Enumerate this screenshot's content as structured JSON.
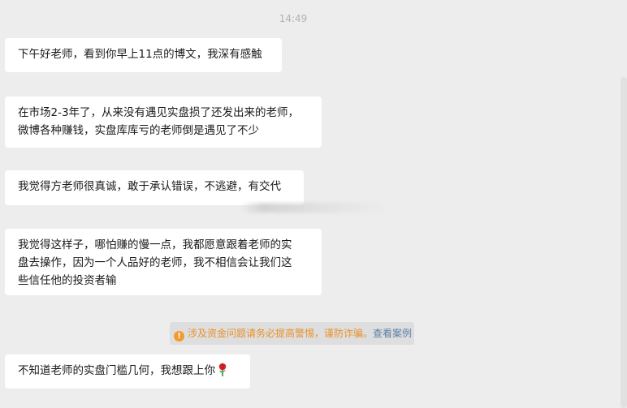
{
  "timestamp": "14:49",
  "messages": [
    {
      "lines": [
        "下午好老师，看到你早上11点的博文，我深有感触"
      ]
    },
    {
      "lines": [
        "在市场2-3年了，从来没有遇见实盘损了还发出来的老师，",
        "微博各种赚钱，实盘库库亏的老师倒是遇见了不少"
      ]
    },
    {
      "lines": [
        "我觉得方老师很真诚，敢于承认错误，不逃避，有交代"
      ]
    },
    {
      "lines": [
        "我觉得这样子，哪怕赚的慢一点，我都愿意跟着老师的实",
        "盘去操作，因为一个人品好的老师，我不相信会让我们这",
        "些信任他的投资者输"
      ]
    },
    {
      "lines": [
        "不知道老师的实盘门槛几何，我想跟上你"
      ],
      "emoji": "rose-icon"
    }
  ],
  "notice": {
    "icon": "info-icon",
    "text": "涉及资金问题请务必提高警惕，谨防诈骗。",
    "link": "查看案例",
    "colors": {
      "text": "#e8912b",
      "link": "#5a7fa8",
      "icon": "#f29a2e"
    }
  }
}
